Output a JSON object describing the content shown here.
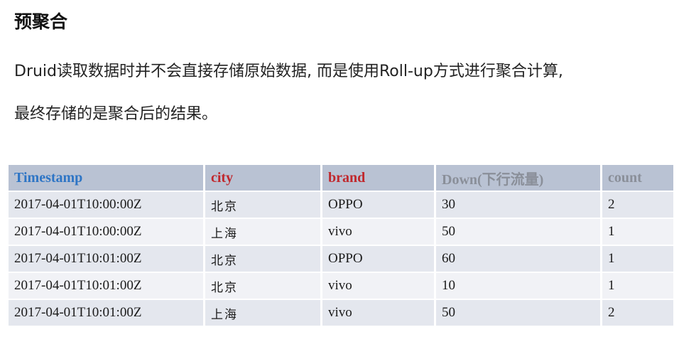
{
  "heading": "预聚合",
  "paragraph": {
    "line1": "Druid读取数据时并不会直接存储原始数据, 而是使用Roll-up方式进行聚合计算,",
    "line2": "最终存储的是聚合后的结果。"
  },
  "table": {
    "headers": [
      {
        "label": "Timestamp",
        "color": "#2e75c5"
      },
      {
        "label": "city",
        "color": "#c0282d"
      },
      {
        "label": "brand",
        "color": "#c0282d"
      },
      {
        "label": "Down(下行流量)",
        "color": "#8a8f99"
      },
      {
        "label": "count",
        "color": "#8a8f99"
      }
    ],
    "rows": [
      [
        "2017-04-01T10:00:00Z",
        "北京",
        "OPPO",
        "30",
        "2"
      ],
      [
        "2017-04-01T10:00:00Z",
        "上海",
        "vivo",
        "50",
        "1"
      ],
      [
        "2017-04-01T10:01:00Z",
        "北京",
        "OPPO",
        "60",
        "1"
      ],
      [
        "2017-04-01T10:01:00Z",
        "北京",
        "vivo",
        "10",
        "1"
      ],
      [
        "2017-04-01T10:01:00Z",
        "上海",
        "vivo",
        "50",
        "2"
      ]
    ]
  }
}
